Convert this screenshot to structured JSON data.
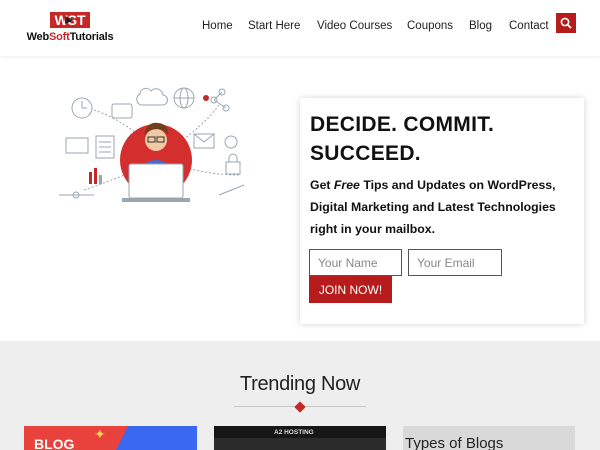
{
  "site": {
    "logo_mark": "WST",
    "logo_text_1": "Web",
    "logo_text_2": "Soft",
    "logo_text_3": "Tutorials"
  },
  "nav": {
    "items": [
      {
        "label": "Home"
      },
      {
        "label": "Start Here"
      },
      {
        "label": "Video Courses"
      },
      {
        "label": "Coupons"
      },
      {
        "label": "Blog"
      },
      {
        "label": "Contact"
      }
    ],
    "search_icon": "search-icon"
  },
  "optin": {
    "title": "DECIDE. COMMIT. SUCCEED.",
    "desc_prefix": "Get ",
    "desc_em": "Free",
    "desc_suffix": " Tips and Updates on WordPress, Digital Marketing and Latest Technologies right in your mailbox.",
    "name_placeholder": "Your Name",
    "email_placeholder": "Your Email",
    "button": "JOIN NOW!"
  },
  "trending": {
    "title": "Trending Now",
    "cards": [
      {
        "label": "BLOG"
      },
      {
        "label": "A2 HOSTING"
      },
      {
        "label": "Types of Blogs"
      }
    ]
  },
  "colors": {
    "accent": "#b71c1c",
    "logo_red": "#c62828",
    "trending_bg": "#eeeeee"
  }
}
